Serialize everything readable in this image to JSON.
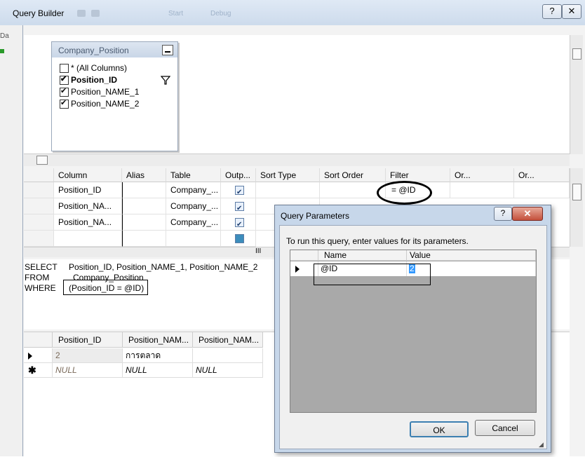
{
  "window": {
    "title": "Query Builder",
    "help_glyph": "?",
    "close_glyph": "✕",
    "toolbar_faded": [
      "Start",
      "Debug"
    ],
    "left_gutter_text": "Da"
  },
  "diagram": {
    "table_name": "Company_Position",
    "columns": [
      {
        "label": "* (All Columns)",
        "checked": false,
        "bold": false
      },
      {
        "label": "Position_ID",
        "checked": true,
        "bold": true,
        "filter": true
      },
      {
        "label": "Position_NAME_1",
        "checked": true,
        "bold": false
      },
      {
        "label": "Position_NAME_2",
        "checked": true,
        "bold": false
      }
    ]
  },
  "criteria_grid": {
    "headers": [
      "Column",
      "Alias",
      "Table",
      "Outp...",
      "Sort Type",
      "Sort Order",
      "Filter",
      "Or...",
      "Or..."
    ],
    "rows": [
      {
        "column": "Position_ID",
        "alias": "",
        "table": "Company_...",
        "output": true,
        "filter": "= @ID"
      },
      {
        "column": "Position_NA...",
        "alias": "",
        "table": "Company_...",
        "output": true,
        "filter": ""
      },
      {
        "column": "Position_NA...",
        "alias": "",
        "table": "Company_...",
        "output": true,
        "filter": ""
      }
    ],
    "scroll_marker": "III"
  },
  "sql": {
    "select_kw": "SELECT",
    "select_val": "Position_ID, Position_NAME_1, Position_NAME_2",
    "from_kw": "FROM",
    "from_val": "Company_Position",
    "where_kw": "WHERE",
    "where_val": "(Position_ID = @ID)"
  },
  "results": {
    "headers": [
      "Position_ID",
      "Position_NAM...",
      "Position_NAM..."
    ],
    "rows": [
      {
        "marker": "arrow",
        "c1": "2",
        "c2": "การตลาด",
        "c3": ""
      },
      {
        "marker": "*",
        "c1": "NULL",
        "c2": "NULL",
        "c3": "NULL"
      }
    ]
  },
  "dialog": {
    "title": "Query Parameters",
    "help_glyph": "?",
    "close_glyph": "✕",
    "instruction": "To run this query, enter values for its parameters.",
    "headers": [
      "Name",
      "Value"
    ],
    "params": [
      {
        "name": "@ID",
        "value": "2"
      }
    ],
    "ok_label": "OK",
    "cancel_label": "Cancel"
  }
}
